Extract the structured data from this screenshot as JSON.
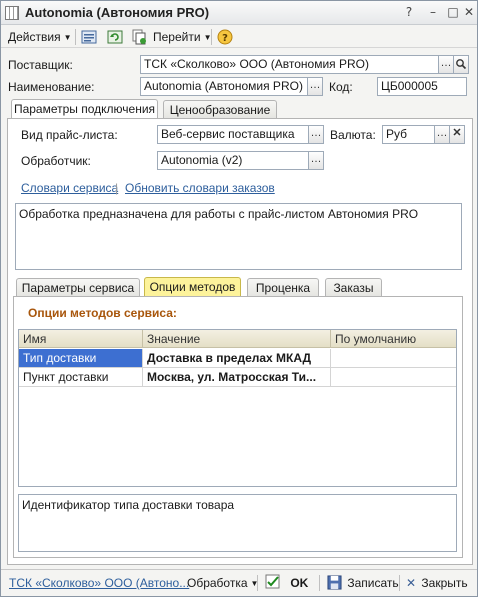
{
  "window": {
    "title": "Autonomia (Автономия PRO)"
  },
  "toolbar": {
    "actions_label": "Действия",
    "goto_label": "Перейти"
  },
  "form": {
    "supplier_label": "Поставщик:",
    "supplier_value": "ТСК «Сколково» ООО (Автономия PRO)",
    "name_label": "Наименование:",
    "name_value": "Autonomia (Автономия PRO)",
    "code_label": "Код:",
    "code_value": "ЦБ000005"
  },
  "tabs": [
    "Параметры подключения",
    "Ценообразование"
  ],
  "connection": {
    "pricelist_type_label": "Вид прайс-листа:",
    "pricelist_type_value": "Веб-сервис поставщика",
    "currency_label": "Валюта:",
    "currency_value": "Руб",
    "handler_label": "Обработчик:",
    "handler_value": "Autonomia (v2)",
    "link_dictionaries": "Словари сервиса",
    "link_update_dictionaries": "Обновить словари заказов",
    "description": "Обработка предназначена для работы с прайс-листом Автономия PRO"
  },
  "subtabs": [
    "Параметры сервиса",
    "Опции методов",
    "Проценка",
    "Заказы"
  ],
  "options": {
    "heading": "Опции методов сервиса:",
    "columns": [
      "Имя",
      "Значение",
      "По умолчанию"
    ],
    "rows": [
      {
        "name": "Тип доставки",
        "value": "Доставка в пределах МКАД",
        "default": ""
      },
      {
        "name": "Пункт доставки",
        "value": "Москва, ул. Матросская Ти...",
        "default": ""
      }
    ],
    "hint": "Идентификатор типа доставки товара"
  },
  "bottom": {
    "link": "ТСК «Сколково» ООО (Автоно...",
    "processing_label": "Обработка",
    "ok_label": "OK",
    "save_label": "Записать",
    "close_label": "Закрыть"
  }
}
